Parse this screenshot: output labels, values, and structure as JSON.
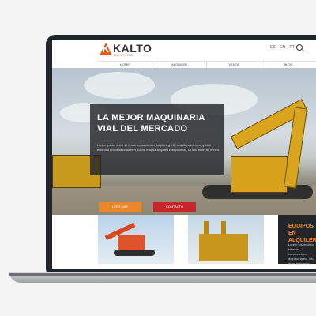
{
  "brand": {
    "name": "KALTO",
    "sub": "RENTING",
    "mark": "K"
  },
  "languages": [
    "ES",
    "EN",
    "PT"
  ],
  "nav": [
    "HOME",
    "ALQUILER",
    "VENTA",
    "BLOG"
  ],
  "hero": {
    "title": "LA MEJOR MAQUINARIA VIAL DEL MERCADO",
    "text": "Lorem ipsum dolor sit amet, consectetuer adipiscing elit, sed diam nonummy nibh euismod tincidunt ut laoreet dolore magna aliquam erat volutpat. Ut wisi enim ad minim.",
    "btn_primary": "LEER MÁS",
    "btn_secondary": "CONTACTO"
  },
  "cards": {
    "dark_title": "EQUIPOS EN ALQUILER",
    "dark_text": "Lorem ipsum dolor sit amet, consectetuer adipiscing elit, sed diam nonummy"
  },
  "colors": {
    "accent": "#e55a1f",
    "orange": "#e8882a",
    "red": "#c7262d",
    "dark": "#232629"
  }
}
